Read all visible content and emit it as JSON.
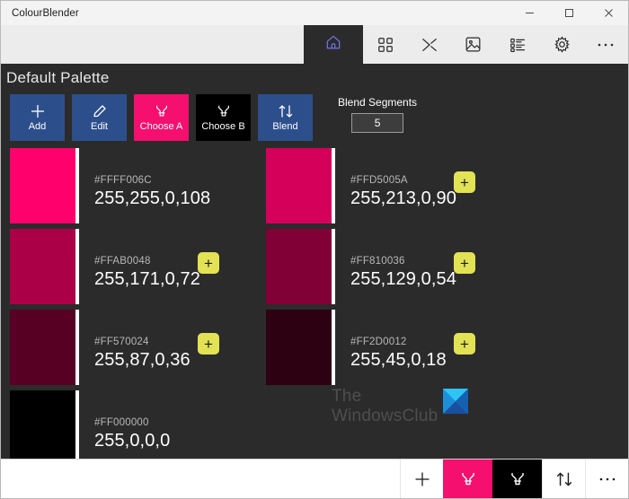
{
  "window": {
    "title": "ColourBlender",
    "controls": [
      {
        "name": "minimize",
        "glyph": "minimize-icon"
      },
      {
        "name": "maximize",
        "glyph": "maximize-icon"
      },
      {
        "name": "close",
        "glyph": "close-icon"
      }
    ]
  },
  "topstrip": {
    "home_tab": "home-icon",
    "icons": [
      {
        "name": "grid-icon",
        "label": "Palettes"
      },
      {
        "name": "shuffle-icon",
        "label": "Blend"
      },
      {
        "name": "image-icon",
        "label": "Image"
      },
      {
        "name": "list-icon",
        "label": "List"
      },
      {
        "name": "gear-icon",
        "label": "Settings"
      },
      {
        "name": "ellipsis-icon",
        "label": "More"
      }
    ]
  },
  "header": {
    "title": "Default Palette"
  },
  "toolbar": {
    "buttons": [
      {
        "id": "add",
        "label": "Add",
        "icon": "plus-icon",
        "style": "blue"
      },
      {
        "id": "edit",
        "label": "Edit",
        "icon": "pencil-icon",
        "style": "blue"
      },
      {
        "id": "choose_a",
        "label": "Choose A",
        "icon": "beaker-icon",
        "style": "pink"
      },
      {
        "id": "choose_b",
        "label": "Choose B",
        "icon": "beaker-icon",
        "style": "black"
      },
      {
        "id": "blend",
        "label": "Blend",
        "icon": "updown-arrows-icon",
        "style": "blue"
      }
    ],
    "blend_segments": {
      "label": "Blend Segments",
      "value": "5",
      "placeholder": "5"
    }
  },
  "palette": {
    "swatches": [
      {
        "hex": "#FFFF006C",
        "argb": "255,255,0,108",
        "color": "#FF006C",
        "has_add": false
      },
      {
        "hex": "#FFD5005A",
        "argb": "255,213,0,90",
        "color": "#D5005A",
        "has_add": true
      },
      {
        "hex": "#FFAB0048",
        "argb": "255,171,0,72",
        "color": "#AB0048",
        "has_add": true
      },
      {
        "hex": "#FF810036",
        "argb": "255,129,0,54",
        "color": "#810036",
        "has_add": true
      },
      {
        "hex": "#FF570024",
        "argb": "255,87,0,36",
        "color": "#570024",
        "has_add": true
      },
      {
        "hex": "#FF2D0012",
        "argb": "255,45,0,18",
        "color": "#2D0012",
        "has_add": true
      },
      {
        "hex": "#FF000000",
        "argb": "255,0,0,0",
        "color": "#000000",
        "has_add": false
      }
    ]
  },
  "watermark": {
    "text": "The\nWindowsClub",
    "logo_color_light": "#2ec5f5",
    "logo_color_dark": "#1560b0"
  },
  "bottombar": {
    "buttons": [
      {
        "id": "add",
        "icon": "plus-icon",
        "style": "white"
      },
      {
        "id": "choose_a",
        "icon": "beaker-icon",
        "style": "pink"
      },
      {
        "id": "choose_b",
        "icon": "beaker-icon",
        "style": "black"
      },
      {
        "id": "blend",
        "icon": "updown-arrows-icon",
        "style": "white"
      },
      {
        "id": "more",
        "icon": "ellipsis-icon",
        "style": "white"
      }
    ]
  },
  "colors": {
    "accent_blue": "#2c4f8c",
    "accent_pink": "#f50f6e",
    "background": "#2b2b2b",
    "add_chip": "#e2e254",
    "home_icon": "#6a6fd8"
  }
}
